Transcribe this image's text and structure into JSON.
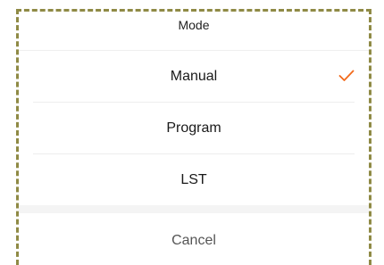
{
  "sheet": {
    "title": "Mode",
    "options": [
      {
        "label": "Manual",
        "selected": true
      },
      {
        "label": "Program",
        "selected": false
      },
      {
        "label": "LST",
        "selected": false
      }
    ],
    "check_icon": "checkmark-icon",
    "check_color": "#f26a1b",
    "cancel_label": "Cancel"
  }
}
